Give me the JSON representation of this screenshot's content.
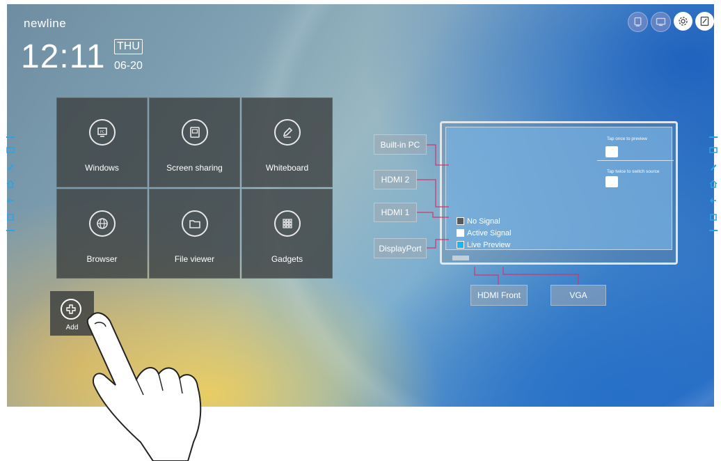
{
  "brand": {
    "name": "newline"
  },
  "clock": {
    "time": "12:11",
    "day": "THU",
    "date": "06-20"
  },
  "top_icons": [
    {
      "name": "pc-screen-icon",
      "state": "dim"
    },
    {
      "name": "display-icon",
      "state": "dim"
    },
    {
      "name": "gear-icon",
      "state": "active"
    },
    {
      "name": "annotate-icon",
      "state": "active"
    }
  ],
  "apps": [
    {
      "label": "Windows",
      "icon": "pc-icon"
    },
    {
      "label": "Screen sharing",
      "icon": "screen-share-icon"
    },
    {
      "label": "Whiteboard",
      "icon": "pen-icon"
    },
    {
      "label": "Browser",
      "icon": "globe-icon"
    },
    {
      "label": "File viewer",
      "icon": "folder-icon"
    },
    {
      "label": "Gadgets",
      "icon": "grid-icon"
    }
  ],
  "add_tile": {
    "label": "Add",
    "icon": "plus-icon"
  },
  "sources": {
    "builtin_pc": "Built-in PC",
    "hdmi2": "HDMI 2",
    "hdmi1": "HDMI 1",
    "displayport": "DisplayPort",
    "hdmi_front": "HDMI Front",
    "vga": "VGA"
  },
  "preview_hints": {
    "tap_once": "Tap once to preview",
    "tap_twice": "Tap twice to switch source"
  },
  "legend": [
    {
      "label": "No Signal",
      "color": "#555a5e"
    },
    {
      "label": "Active Signal",
      "color": "#ffffff"
    },
    {
      "label": "Live Preview",
      "color": "#1fb4ef"
    }
  ],
  "colors": {
    "connector": "#d6336c",
    "side_accent": "#2aa4e6",
    "tile": "#3e4242"
  }
}
